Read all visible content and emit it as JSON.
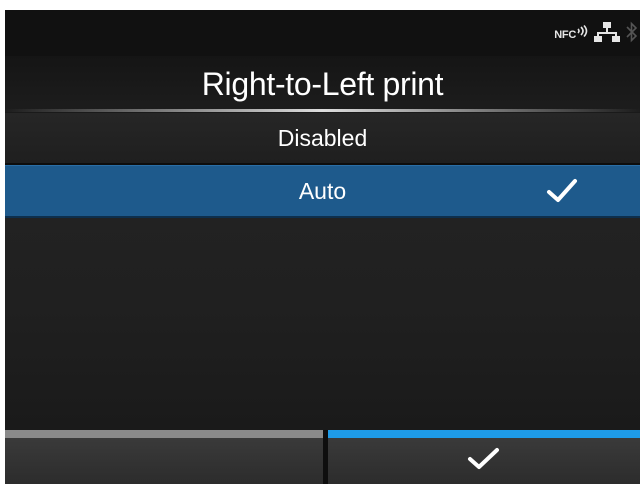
{
  "status_bar": {
    "nfc_label": "NFC",
    "icons": [
      "nfc-icon",
      "lan-icon",
      "bluetooth-icon"
    ]
  },
  "title": "Right-to-Left print",
  "options": [
    {
      "label": "Disabled",
      "selected": false
    },
    {
      "label": "Auto",
      "selected": true
    }
  ],
  "footer": {
    "left_button": "back",
    "right_button_icon": "check-icon"
  },
  "colors": {
    "background": "#1a1a1a",
    "selected_row": "#1e5a8c",
    "confirm_accent": "#1e9be8",
    "back_accent": "#8a8a8a",
    "text": "#ffffff"
  }
}
